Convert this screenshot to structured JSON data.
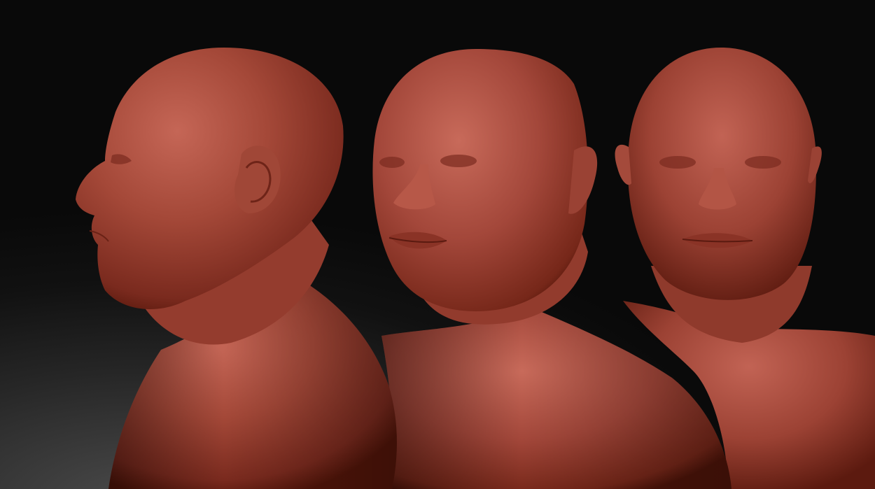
{
  "scene": {
    "busts": [
      {
        "view": "left-profile"
      },
      {
        "view": "three-quarter"
      },
      {
        "view": "front"
      }
    ]
  },
  "colors": {
    "background_top": "#0b0b0b",
    "background_glow": "#4a4a4a",
    "clay_light": "#c9695a",
    "clay_mid": "#9e3f31",
    "clay_dark": "#4a130c"
  }
}
